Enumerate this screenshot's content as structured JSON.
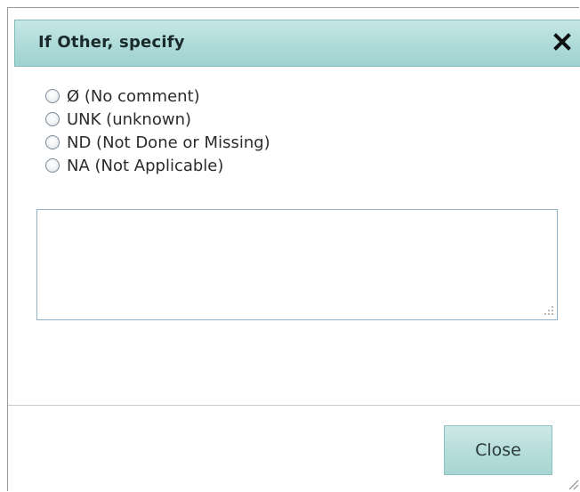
{
  "dialog": {
    "title": "If Other, specify",
    "close_icon": "close-x-icon",
    "options": [
      {
        "label": "Ø (No comment)"
      },
      {
        "label": "UNK (unknown)"
      },
      {
        "label": "ND (Not Done or Missing)"
      },
      {
        "label": "NA (Not Applicable)"
      }
    ],
    "comment": {
      "value": "",
      "placeholder": ""
    },
    "close_button_label": "Close"
  },
  "colors": {
    "titlebar": "#b2dddb",
    "button": "#b7dedb",
    "input_border": "#8fb2cc"
  }
}
